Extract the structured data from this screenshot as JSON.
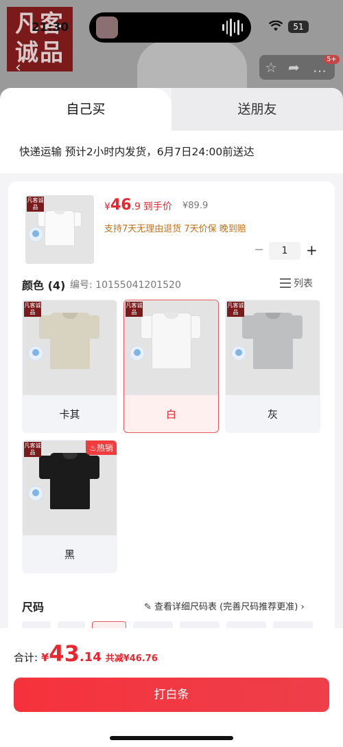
{
  "status": {
    "time": "21:30",
    "battery": "51"
  },
  "background": {
    "logo_line1": "凡客",
    "logo_line2": "诚品",
    "cart_badge": "5+"
  },
  "tabs": {
    "own": "自己买",
    "friend": "送朋友"
  },
  "delivery": {
    "text": "快递运输 预计2小时内发货，6月7日24:00前送达"
  },
  "product": {
    "price_symbol": "¥",
    "price_int": "46",
    "price_dec": ".9",
    "price_label": "到手价",
    "original_price": "¥89.9",
    "guarantees": "支持7天无理由退货  7天价保  晚到赔",
    "quantity": "1",
    "thumb_logo": "凡客诚品"
  },
  "color_section": {
    "title": "颜色 (4)",
    "sku": "编号: 10155041201520",
    "list_label": "列表",
    "options": [
      {
        "name": "卡其",
        "color": "#d8d2c0",
        "selected": false,
        "hot": false
      },
      {
        "name": "白",
        "color": "#f4f4f4",
        "selected": true,
        "hot": false
      },
      {
        "name": "灰",
        "color": "#bdbfc1",
        "selected": false,
        "hot": false
      },
      {
        "name": "黑",
        "color": "#1b1b1b",
        "selected": false,
        "hot": true
      }
    ],
    "hot_label": "热销",
    "logo": "凡客诚品"
  },
  "size_section": {
    "title": "尺码",
    "link": "查看详细尺码表 (完善尺码推荐更准)"
  },
  "bottom": {
    "total_label": "合计:",
    "currency": "¥",
    "total_int": "43",
    "total_dec": ".14",
    "saved": "共减¥46.76",
    "buy_button": "打白条"
  },
  "colors": {
    "accent": "#e8262f",
    "brand_logo": "#7a1a1a"
  }
}
